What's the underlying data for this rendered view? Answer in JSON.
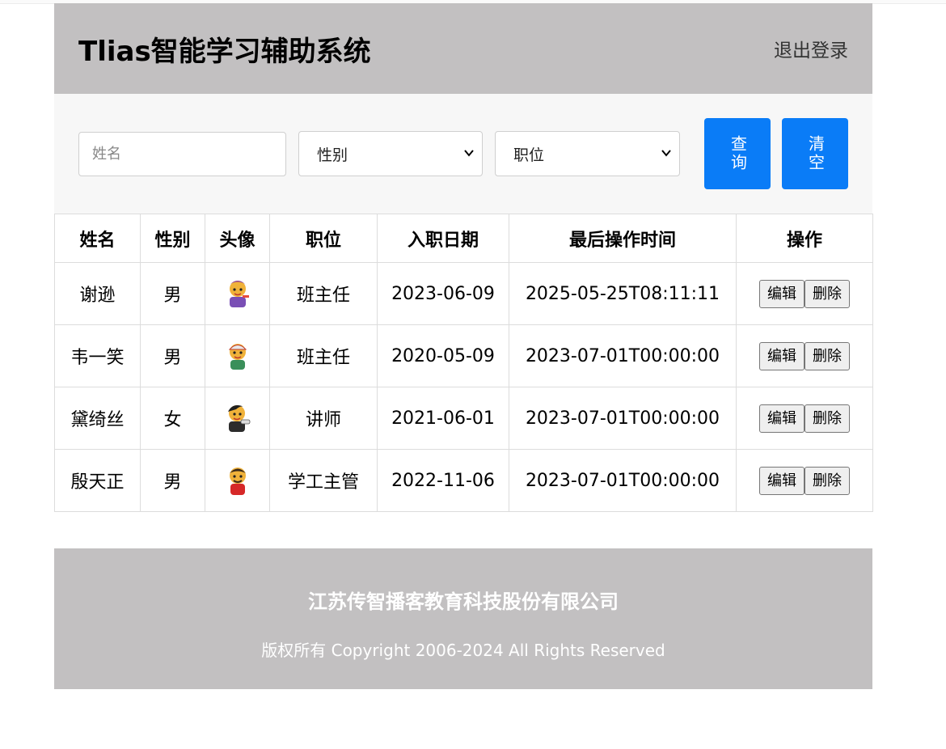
{
  "header": {
    "title": "Tlias智能学习辅助系统",
    "logout_label": "退出登录"
  },
  "search": {
    "name_placeholder": "姓名",
    "gender_selected": "性别",
    "position_selected": "职位",
    "query_label": "查询",
    "clear_label": "清空"
  },
  "table": {
    "headers": [
      "姓名",
      "性别",
      "头像",
      "职位",
      "入职日期",
      "最后操作时间",
      "操作"
    ],
    "edit_label": "编辑",
    "delete_label": "删除",
    "rows": [
      {
        "name": "谢逊",
        "gender": "男",
        "avatar": "avatar-icon",
        "position": "班主任",
        "entry_date": "2023-06-09",
        "update_time": "2025-05-25T08:11:11"
      },
      {
        "name": "韦一笑",
        "gender": "男",
        "avatar": "avatar-icon",
        "position": "班主任",
        "entry_date": "2020-05-09",
        "update_time": "2023-07-01T00:00:00"
      },
      {
        "name": "黛绮丝",
        "gender": "女",
        "avatar": "avatar-icon",
        "position": "讲师",
        "entry_date": "2021-06-01",
        "update_time": "2023-07-01T00:00:00"
      },
      {
        "name": "殷天正",
        "gender": "男",
        "avatar": "avatar-icon",
        "position": "学工主管",
        "entry_date": "2022-11-06",
        "update_time": "2023-07-01T00:00:00"
      }
    ]
  },
  "footer": {
    "company": "江苏传智播客教育科技股份有限公司",
    "copyright": "版权所有 Copyright 2006-2024 All Rights Reserved"
  },
  "colors": {
    "header_bg": "#c2c0c1",
    "accent_button": "#0a7cf7",
    "search_bg": "#f7f7f7"
  }
}
